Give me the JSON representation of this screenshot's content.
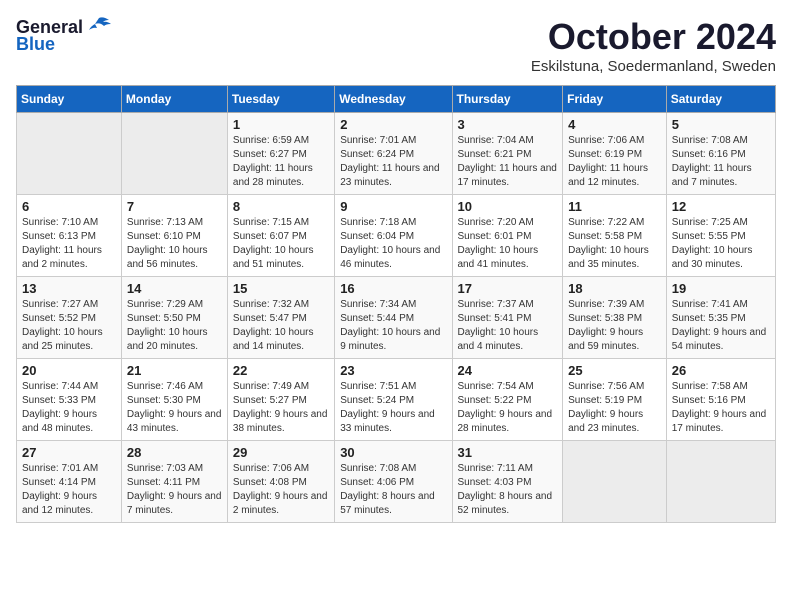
{
  "header": {
    "logo_general": "General",
    "logo_blue": "Blue",
    "month_title": "October 2024",
    "location": "Eskilstuna, Soedermanland, Sweden"
  },
  "weekdays": [
    "Sunday",
    "Monday",
    "Tuesday",
    "Wednesday",
    "Thursday",
    "Friday",
    "Saturday"
  ],
  "weeks": [
    [
      {
        "day": "",
        "empty": true
      },
      {
        "day": "",
        "empty": true
      },
      {
        "day": "1",
        "sunrise": "Sunrise: 6:59 AM",
        "sunset": "Sunset: 6:27 PM",
        "daylight": "Daylight: 11 hours and 28 minutes."
      },
      {
        "day": "2",
        "sunrise": "Sunrise: 7:01 AM",
        "sunset": "Sunset: 6:24 PM",
        "daylight": "Daylight: 11 hours and 23 minutes."
      },
      {
        "day": "3",
        "sunrise": "Sunrise: 7:04 AM",
        "sunset": "Sunset: 6:21 PM",
        "daylight": "Daylight: 11 hours and 17 minutes."
      },
      {
        "day": "4",
        "sunrise": "Sunrise: 7:06 AM",
        "sunset": "Sunset: 6:19 PM",
        "daylight": "Daylight: 11 hours and 12 minutes."
      },
      {
        "day": "5",
        "sunrise": "Sunrise: 7:08 AM",
        "sunset": "Sunset: 6:16 PM",
        "daylight": "Daylight: 11 hours and 7 minutes."
      }
    ],
    [
      {
        "day": "6",
        "sunrise": "Sunrise: 7:10 AM",
        "sunset": "Sunset: 6:13 PM",
        "daylight": "Daylight: 11 hours and 2 minutes."
      },
      {
        "day": "7",
        "sunrise": "Sunrise: 7:13 AM",
        "sunset": "Sunset: 6:10 PM",
        "daylight": "Daylight: 10 hours and 56 minutes."
      },
      {
        "day": "8",
        "sunrise": "Sunrise: 7:15 AM",
        "sunset": "Sunset: 6:07 PM",
        "daylight": "Daylight: 10 hours and 51 minutes."
      },
      {
        "day": "9",
        "sunrise": "Sunrise: 7:18 AM",
        "sunset": "Sunset: 6:04 PM",
        "daylight": "Daylight: 10 hours and 46 minutes."
      },
      {
        "day": "10",
        "sunrise": "Sunrise: 7:20 AM",
        "sunset": "Sunset: 6:01 PM",
        "daylight": "Daylight: 10 hours and 41 minutes."
      },
      {
        "day": "11",
        "sunrise": "Sunrise: 7:22 AM",
        "sunset": "Sunset: 5:58 PM",
        "daylight": "Daylight: 10 hours and 35 minutes."
      },
      {
        "day": "12",
        "sunrise": "Sunrise: 7:25 AM",
        "sunset": "Sunset: 5:55 PM",
        "daylight": "Daylight: 10 hours and 30 minutes."
      }
    ],
    [
      {
        "day": "13",
        "sunrise": "Sunrise: 7:27 AM",
        "sunset": "Sunset: 5:52 PM",
        "daylight": "Daylight: 10 hours and 25 minutes."
      },
      {
        "day": "14",
        "sunrise": "Sunrise: 7:29 AM",
        "sunset": "Sunset: 5:50 PM",
        "daylight": "Daylight: 10 hours and 20 minutes."
      },
      {
        "day": "15",
        "sunrise": "Sunrise: 7:32 AM",
        "sunset": "Sunset: 5:47 PM",
        "daylight": "Daylight: 10 hours and 14 minutes."
      },
      {
        "day": "16",
        "sunrise": "Sunrise: 7:34 AM",
        "sunset": "Sunset: 5:44 PM",
        "daylight": "Daylight: 10 hours and 9 minutes."
      },
      {
        "day": "17",
        "sunrise": "Sunrise: 7:37 AM",
        "sunset": "Sunset: 5:41 PM",
        "daylight": "Daylight: 10 hours and 4 minutes."
      },
      {
        "day": "18",
        "sunrise": "Sunrise: 7:39 AM",
        "sunset": "Sunset: 5:38 PM",
        "daylight": "Daylight: 9 hours and 59 minutes."
      },
      {
        "day": "19",
        "sunrise": "Sunrise: 7:41 AM",
        "sunset": "Sunset: 5:35 PM",
        "daylight": "Daylight: 9 hours and 54 minutes."
      }
    ],
    [
      {
        "day": "20",
        "sunrise": "Sunrise: 7:44 AM",
        "sunset": "Sunset: 5:33 PM",
        "daylight": "Daylight: 9 hours and 48 minutes."
      },
      {
        "day": "21",
        "sunrise": "Sunrise: 7:46 AM",
        "sunset": "Sunset: 5:30 PM",
        "daylight": "Daylight: 9 hours and 43 minutes."
      },
      {
        "day": "22",
        "sunrise": "Sunrise: 7:49 AM",
        "sunset": "Sunset: 5:27 PM",
        "daylight": "Daylight: 9 hours and 38 minutes."
      },
      {
        "day": "23",
        "sunrise": "Sunrise: 7:51 AM",
        "sunset": "Sunset: 5:24 PM",
        "daylight": "Daylight: 9 hours and 33 minutes."
      },
      {
        "day": "24",
        "sunrise": "Sunrise: 7:54 AM",
        "sunset": "Sunset: 5:22 PM",
        "daylight": "Daylight: 9 hours and 28 minutes."
      },
      {
        "day": "25",
        "sunrise": "Sunrise: 7:56 AM",
        "sunset": "Sunset: 5:19 PM",
        "daylight": "Daylight: 9 hours and 23 minutes."
      },
      {
        "day": "26",
        "sunrise": "Sunrise: 7:58 AM",
        "sunset": "Sunset: 5:16 PM",
        "daylight": "Daylight: 9 hours and 17 minutes."
      }
    ],
    [
      {
        "day": "27",
        "sunrise": "Sunrise: 7:01 AM",
        "sunset": "Sunset: 4:14 PM",
        "daylight": "Daylight: 9 hours and 12 minutes."
      },
      {
        "day": "28",
        "sunrise": "Sunrise: 7:03 AM",
        "sunset": "Sunset: 4:11 PM",
        "daylight": "Daylight: 9 hours and 7 minutes."
      },
      {
        "day": "29",
        "sunrise": "Sunrise: 7:06 AM",
        "sunset": "Sunset: 4:08 PM",
        "daylight": "Daylight: 9 hours and 2 minutes."
      },
      {
        "day": "30",
        "sunrise": "Sunrise: 7:08 AM",
        "sunset": "Sunset: 4:06 PM",
        "daylight": "Daylight: 8 hours and 57 minutes."
      },
      {
        "day": "31",
        "sunrise": "Sunrise: 7:11 AM",
        "sunset": "Sunset: 4:03 PM",
        "daylight": "Daylight: 8 hours and 52 minutes."
      },
      {
        "day": "",
        "empty": true
      },
      {
        "day": "",
        "empty": true
      }
    ]
  ]
}
